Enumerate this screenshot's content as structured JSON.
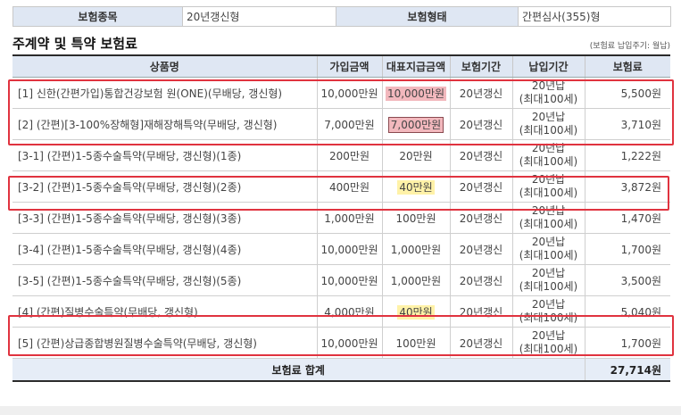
{
  "info": {
    "h1": "보험종목",
    "v1": "20년갱신형",
    "h2": "보험형태",
    "v2": "간편심사(355)형"
  },
  "section": {
    "title": "주계약 및 특약 보험료",
    "note": "(보험료 납입주기: 월납)"
  },
  "columns": [
    "상품명",
    "가입금액",
    "대표지급금액",
    "보험기간",
    "납입기간",
    "보험료"
  ],
  "rows": [
    {
      "name": "[1] 신한(간편가입)통합건강보험 원(ONE)(무배당, 갱신형)",
      "amount": "10,000만원",
      "rep": "10,000만원",
      "term": "20년갱신",
      "pay1": "20년납",
      "pay2": "(최대100세)",
      "prem": "5,500원"
    },
    {
      "name": "[2] (간편)[3-100%장해형]재해장해특약(무배당, 갱신형)",
      "amount": "7,000만원",
      "rep": "7,000만원",
      "term": "20년갱신",
      "pay1": "20년납",
      "pay2": "(최대100세)",
      "prem": "3,710원"
    },
    {
      "name": "[3-1] (간편)1-5종수술특약(무배당, 갱신형)(1종)",
      "amount": "200만원",
      "rep": "20만원",
      "term": "20년갱신",
      "pay1": "20년납",
      "pay2": "(최대100세)",
      "prem": "1,222원"
    },
    {
      "name": "[3-2] (간편)1-5종수술특약(무배당, 갱신형)(2종)",
      "amount": "400만원",
      "rep": "40만원",
      "term": "20년갱신",
      "pay1": "20년납",
      "pay2": "(최대100세)",
      "prem": "3,872원"
    },
    {
      "name": "[3-3] (간편)1-5종수술특약(무배당, 갱신형)(3종)",
      "amount": "1,000만원",
      "rep": "100만원",
      "term": "20년갱신",
      "pay1": "20년납",
      "pay2": "(최대100세)",
      "prem": "1,470원"
    },
    {
      "name": "[3-4] (간편)1-5종수술특약(무배당, 갱신형)(4종)",
      "amount": "10,000만원",
      "rep": "1,000만원",
      "term": "20년갱신",
      "pay1": "20년납",
      "pay2": "(최대100세)",
      "prem": "1,700원"
    },
    {
      "name": "[3-5] (간편)1-5종수술특약(무배당, 갱신형)(5종)",
      "amount": "10,000만원",
      "rep": "1,000만원",
      "term": "20년갱신",
      "pay1": "20년납",
      "pay2": "(최대100세)",
      "prem": "3,500원"
    },
    {
      "name": "[4] (간편)질병수술특약(무배당, 갱신형)",
      "amount": "4,000만원",
      "rep": "40만원",
      "term": "20년갱신",
      "pay1": "20년납",
      "pay2": "(최대100세)",
      "prem": "5,040원"
    },
    {
      "name": "[5] (간편)상급종합병원질병수술특약(무배당, 갱신형)",
      "amount": "10,000만원",
      "rep": "100만원",
      "term": "20년갱신",
      "pay1": "20년납",
      "pay2": "(최대100세)",
      "prem": "1,700원"
    }
  ],
  "total": {
    "label": "보험료 합계",
    "value": "27,714원"
  }
}
